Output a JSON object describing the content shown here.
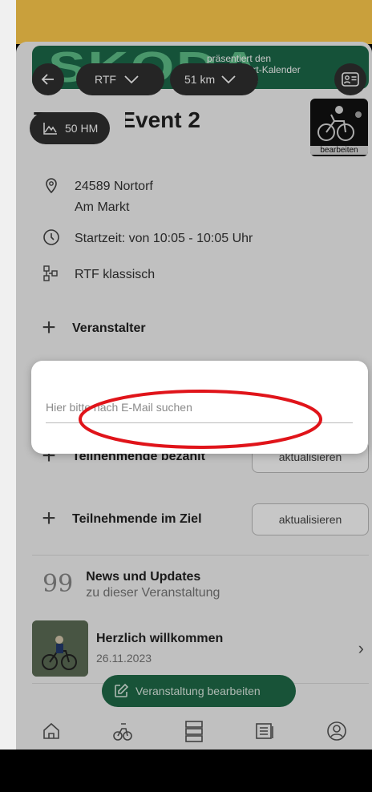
{
  "colors": {
    "accent_green": "#1f6b48",
    "banner_green": "#1c6a4a",
    "annotation_red": "#e0141a"
  },
  "banner": {
    "logo_text": "SKODA",
    "line1": "präsentiert den",
    "line2": "Breitensport-Kalender"
  },
  "filters": {
    "type_label": "RTF",
    "distance_label": "51 km",
    "elevation_label": "50 HM"
  },
  "event": {
    "title": "Tutorial Event 2",
    "image_label": "bearbeiten",
    "zip_city": "24589 Nortorf",
    "street": "Am Markt",
    "start_time": "Startzeit: von 10:05 - 10:05 Uhr",
    "category": "RTF klassisch"
  },
  "sections": {
    "organizer": "Veranstalter",
    "paid": "Teilnehmende bezahlt",
    "finished": "Teilnehmende im Ziel",
    "update_label": "aktualisieren"
  },
  "news": {
    "title": "News und Updates",
    "subtitle": "zu dieser Veranstaltung",
    "item_title": "Herzlich willkommen",
    "item_date": "26.11.2023"
  },
  "fab_label": "Veranstaltung bearbeiten",
  "dialog": {
    "search_placeholder": "Hier bitte nach E-Mail suchen",
    "search_value": ""
  },
  "bottom_nav": [
    "home-icon",
    "bike-icon",
    "list-icon",
    "news-icon",
    "profile-icon"
  ]
}
